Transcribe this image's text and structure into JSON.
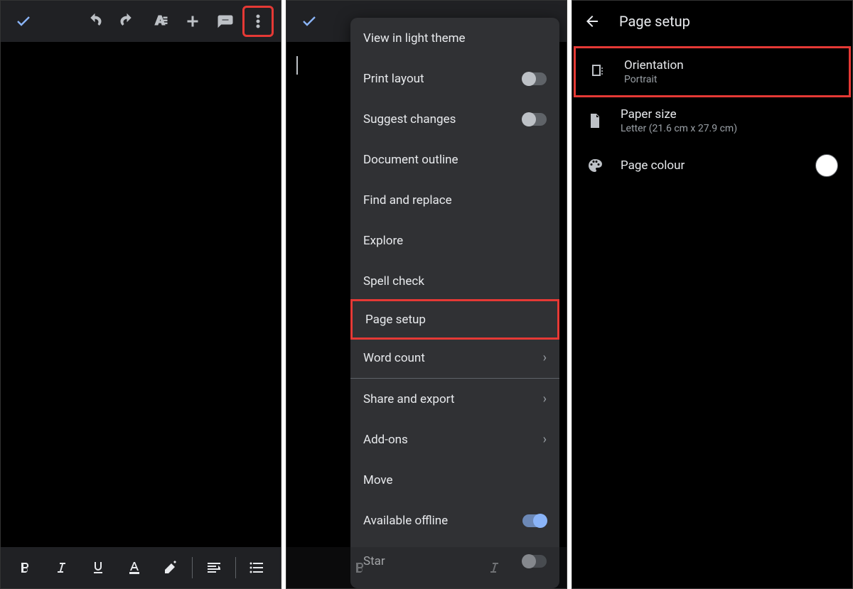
{
  "panel1": {
    "toolbar": {
      "check": "done",
      "undo": "undo",
      "redo": "redo",
      "textformat": "text-format",
      "insert": "insert",
      "comment": "comment",
      "more": "more"
    },
    "bottombar": {
      "bold": "B",
      "italic": "I",
      "underline": "U",
      "textcolor": "A"
    }
  },
  "panel2": {
    "menu": {
      "view_light_theme": "View in light theme",
      "print_layout": "Print layout",
      "suggest_changes": "Suggest changes",
      "document_outline": "Document outline",
      "find_replace": "Find and replace",
      "explore": "Explore",
      "spell_check": "Spell check",
      "page_setup": "Page setup",
      "word_count": "Word count",
      "share_export": "Share and export",
      "add_ons": "Add-ons",
      "move": "Move",
      "available_offline": "Available offline",
      "star": "Star"
    },
    "toggles": {
      "print_layout": false,
      "suggest_changes": false,
      "available_offline": true,
      "star": false
    }
  },
  "panel3": {
    "header": {
      "title": "Page setup"
    },
    "orientation": {
      "label": "Orientation",
      "value": "Portrait"
    },
    "paper_size": {
      "label": "Paper size",
      "value": "Letter (21.6 cm x 27.9 cm)"
    },
    "page_colour": {
      "label": "Page colour",
      "value": "#ffffff"
    }
  }
}
